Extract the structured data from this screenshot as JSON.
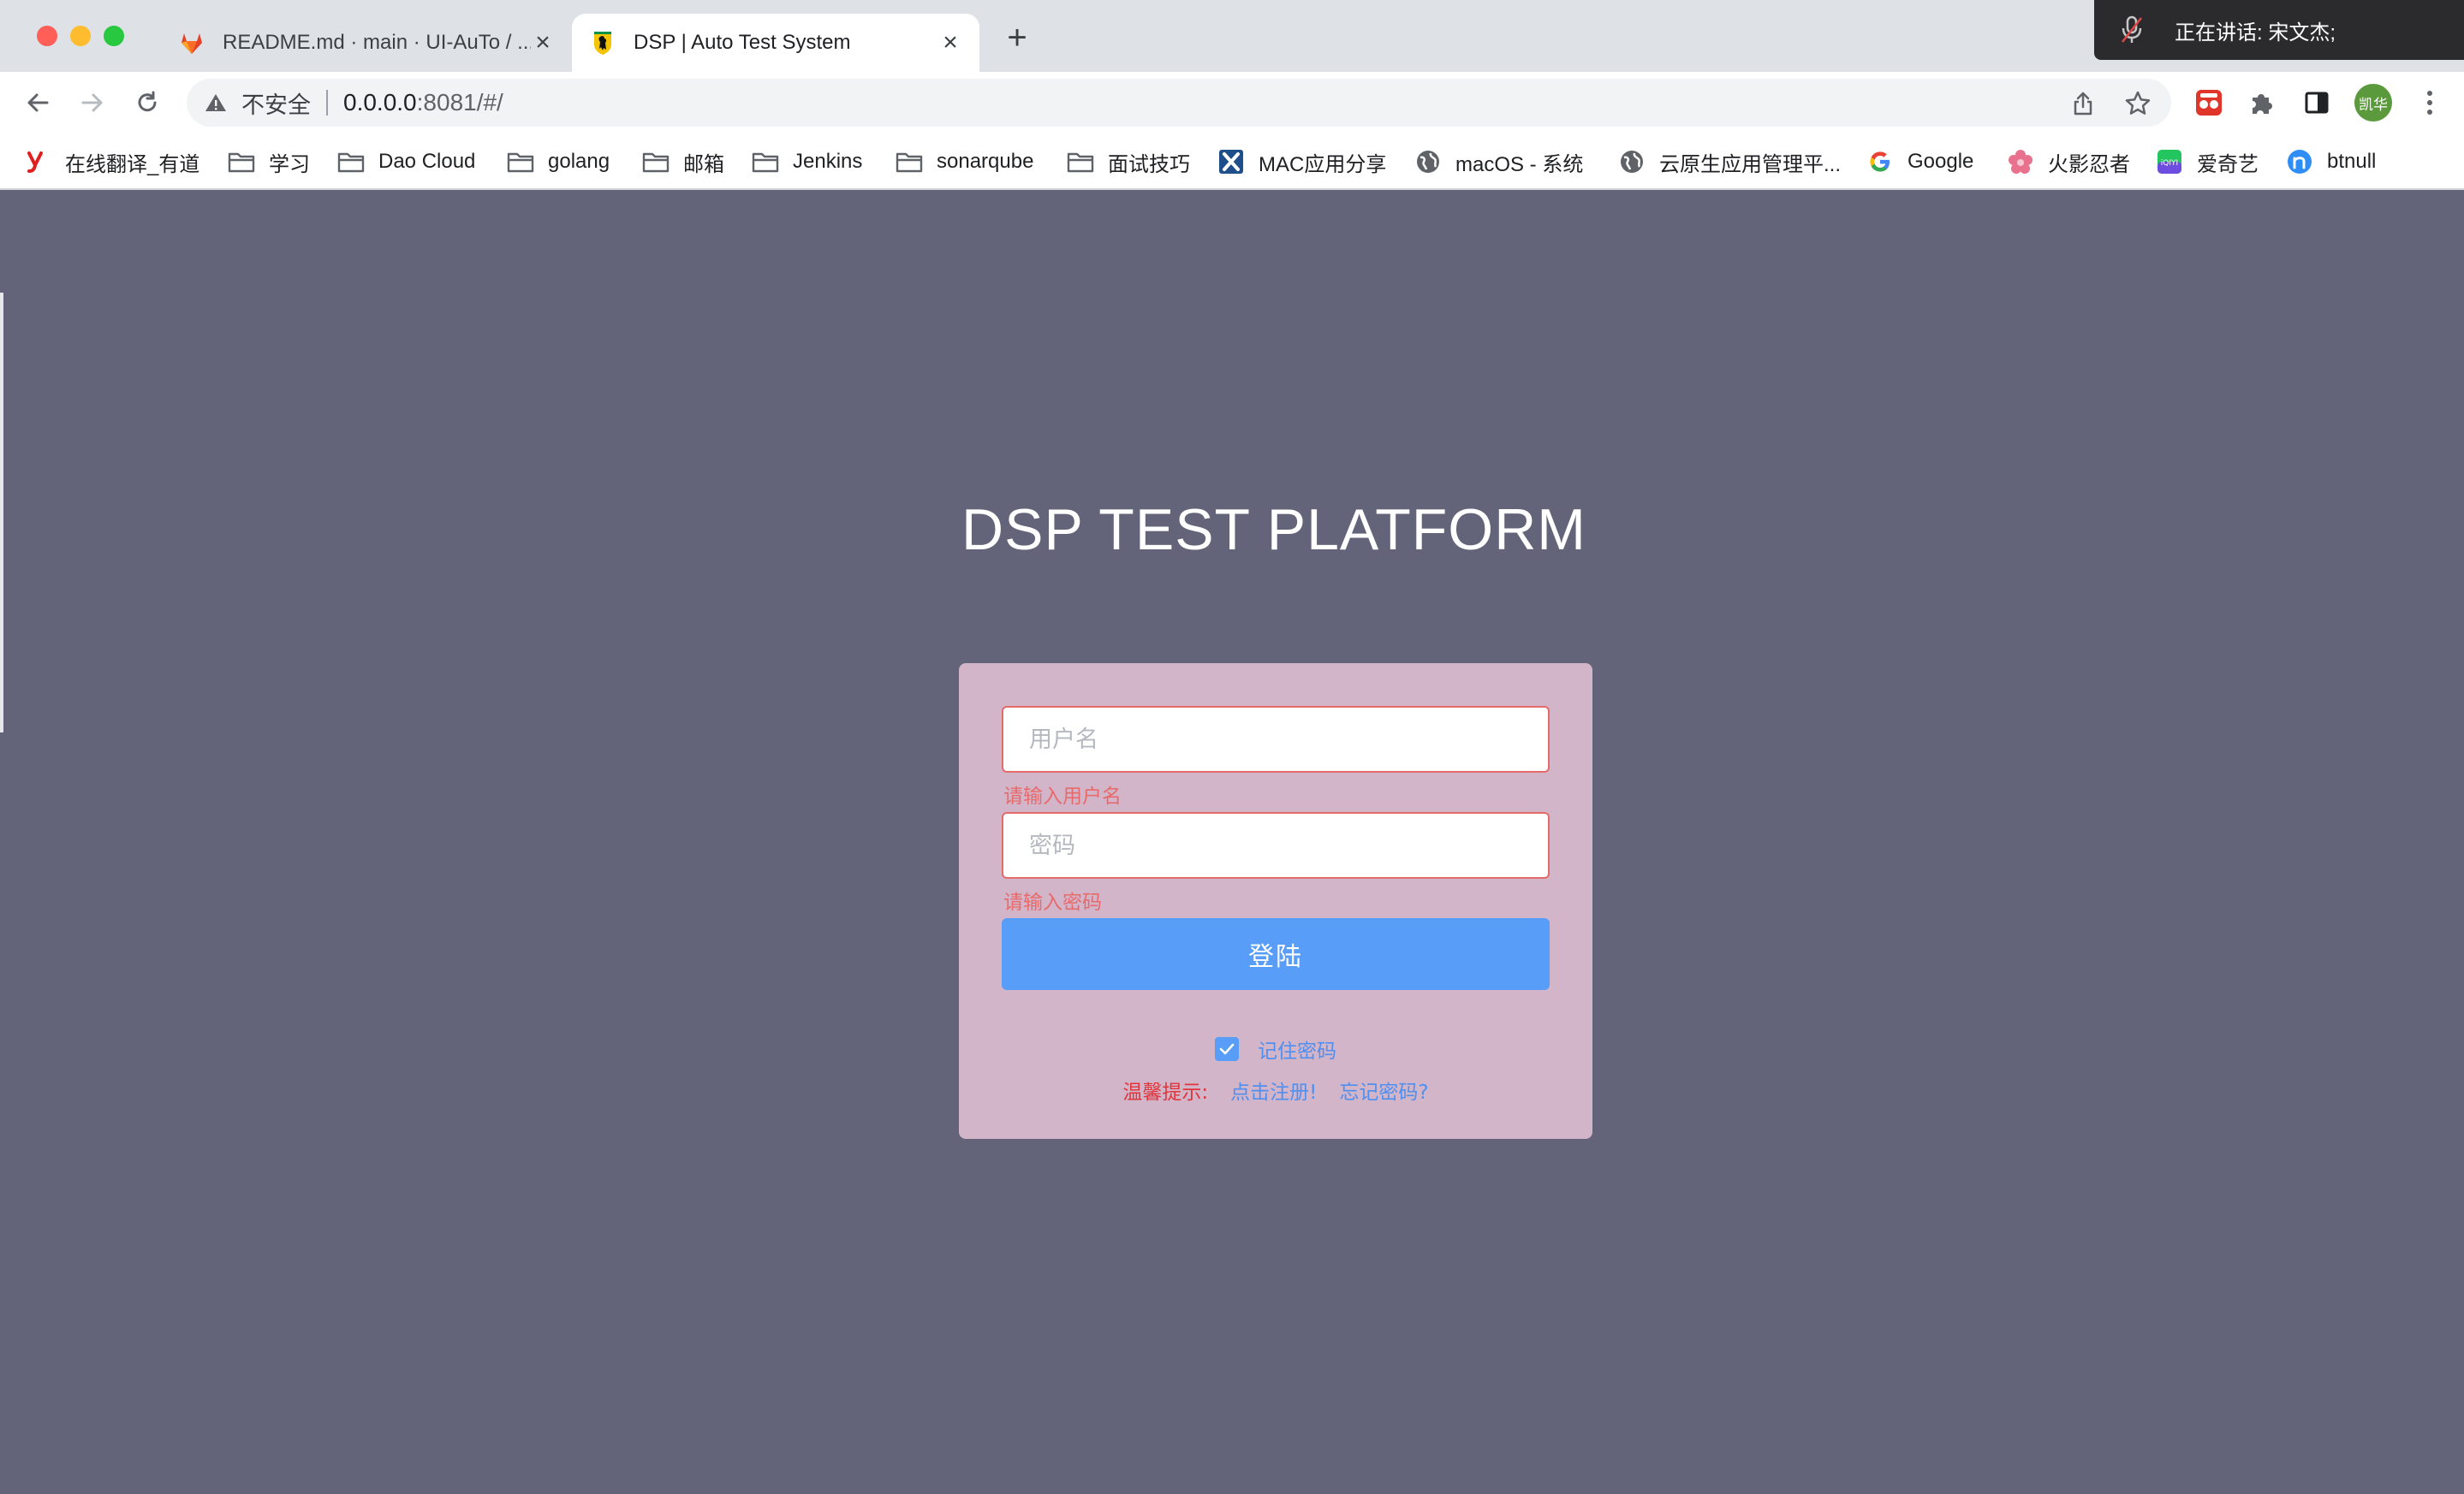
{
  "browser": {
    "tabs": [
      {
        "title": "README.md · main · UI-AuTo / ...",
        "active": false
      },
      {
        "title": "DSP | Auto Test System",
        "active": true
      }
    ],
    "new_tab_label": "+",
    "close_label": "×",
    "meeting_banner": "正在讲话: 宋文杰;",
    "address": {
      "security_label": "不安全",
      "host": "0.0.0.0",
      "path": ":8081/#/"
    },
    "profile_initials": "凯华",
    "bookmarks": [
      {
        "label": "在线翻译_有道",
        "icon": "youdao-icon"
      },
      {
        "label": "学习",
        "icon": "folder-icon"
      },
      {
        "label": "Dao Cloud",
        "icon": "folder-icon"
      },
      {
        "label": "golang",
        "icon": "folder-icon"
      },
      {
        "label": "邮箱",
        "icon": "folder-icon"
      },
      {
        "label": "Jenkins",
        "icon": "folder-icon"
      },
      {
        "label": "sonarqube",
        "icon": "folder-icon"
      },
      {
        "label": "面试技巧",
        "icon": "folder-icon"
      },
      {
        "label": "MAC应用分享",
        "icon": "x-app-icon"
      },
      {
        "label": "macOS - 系统",
        "icon": "globe-icon"
      },
      {
        "label": "云原生应用管理平...",
        "icon": "globe-icon"
      },
      {
        "label": "Google",
        "icon": "google-icon"
      },
      {
        "label": "火影忍者",
        "icon": "flower-icon"
      },
      {
        "label": "爱奇艺",
        "icon": "iqiyi-icon"
      },
      {
        "label": "btnull",
        "icon": "n-icon"
      }
    ]
  },
  "page": {
    "title": "DSP TEST PLATFORM",
    "login": {
      "username_placeholder": "用户名",
      "username_error": "请输入用户名",
      "password_placeholder": "密码",
      "password_error": "请输入密码",
      "submit_label": "登陆",
      "remember_label": "记住密码",
      "remember_checked": true,
      "tip_label": "温馨提示:",
      "register_link": "点击注册!",
      "forgot_link": "忘记密码?"
    }
  },
  "colors": {
    "page_bg": "#63647a",
    "card_bg": "#d2b5c9",
    "primary": "#589df8",
    "error": "#e86a6a",
    "tip": "#e0353a"
  }
}
